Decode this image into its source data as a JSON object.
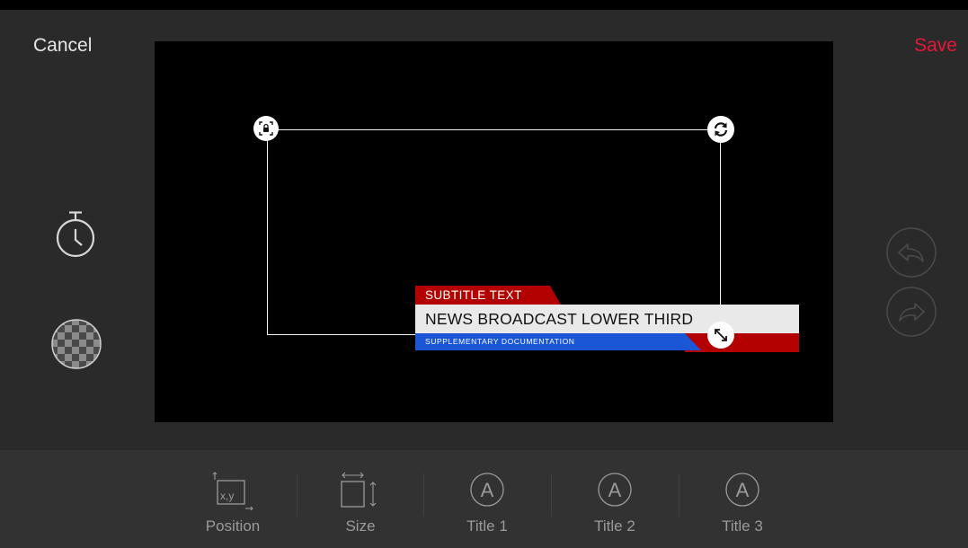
{
  "header": {
    "cancel_label": "Cancel",
    "save_label": "Save"
  },
  "lower_third": {
    "subtitle": "SUBTITLE TEXT",
    "headline": "NEWS BROADCAST LOWER THIRD",
    "supplementary": "SUPPLEMENTARY DOCUMENTATION"
  },
  "toolbar": {
    "items": [
      {
        "label": "Position",
        "icon": "position-icon",
        "glyph": "x,y"
      },
      {
        "label": "Size",
        "icon": "size-icon"
      },
      {
        "label": "Title 1",
        "icon": "font-a-icon",
        "glyph": "A"
      },
      {
        "label": "Title 2",
        "icon": "font-a-icon",
        "glyph": "A"
      },
      {
        "label": "Title 3",
        "icon": "font-a-icon",
        "glyph": "A"
      }
    ]
  },
  "colors": {
    "accent": "#e8173a",
    "lower_third_red": "#b30000",
    "lower_third_blue": "#1a56d6",
    "background": "#2a2a2a"
  }
}
